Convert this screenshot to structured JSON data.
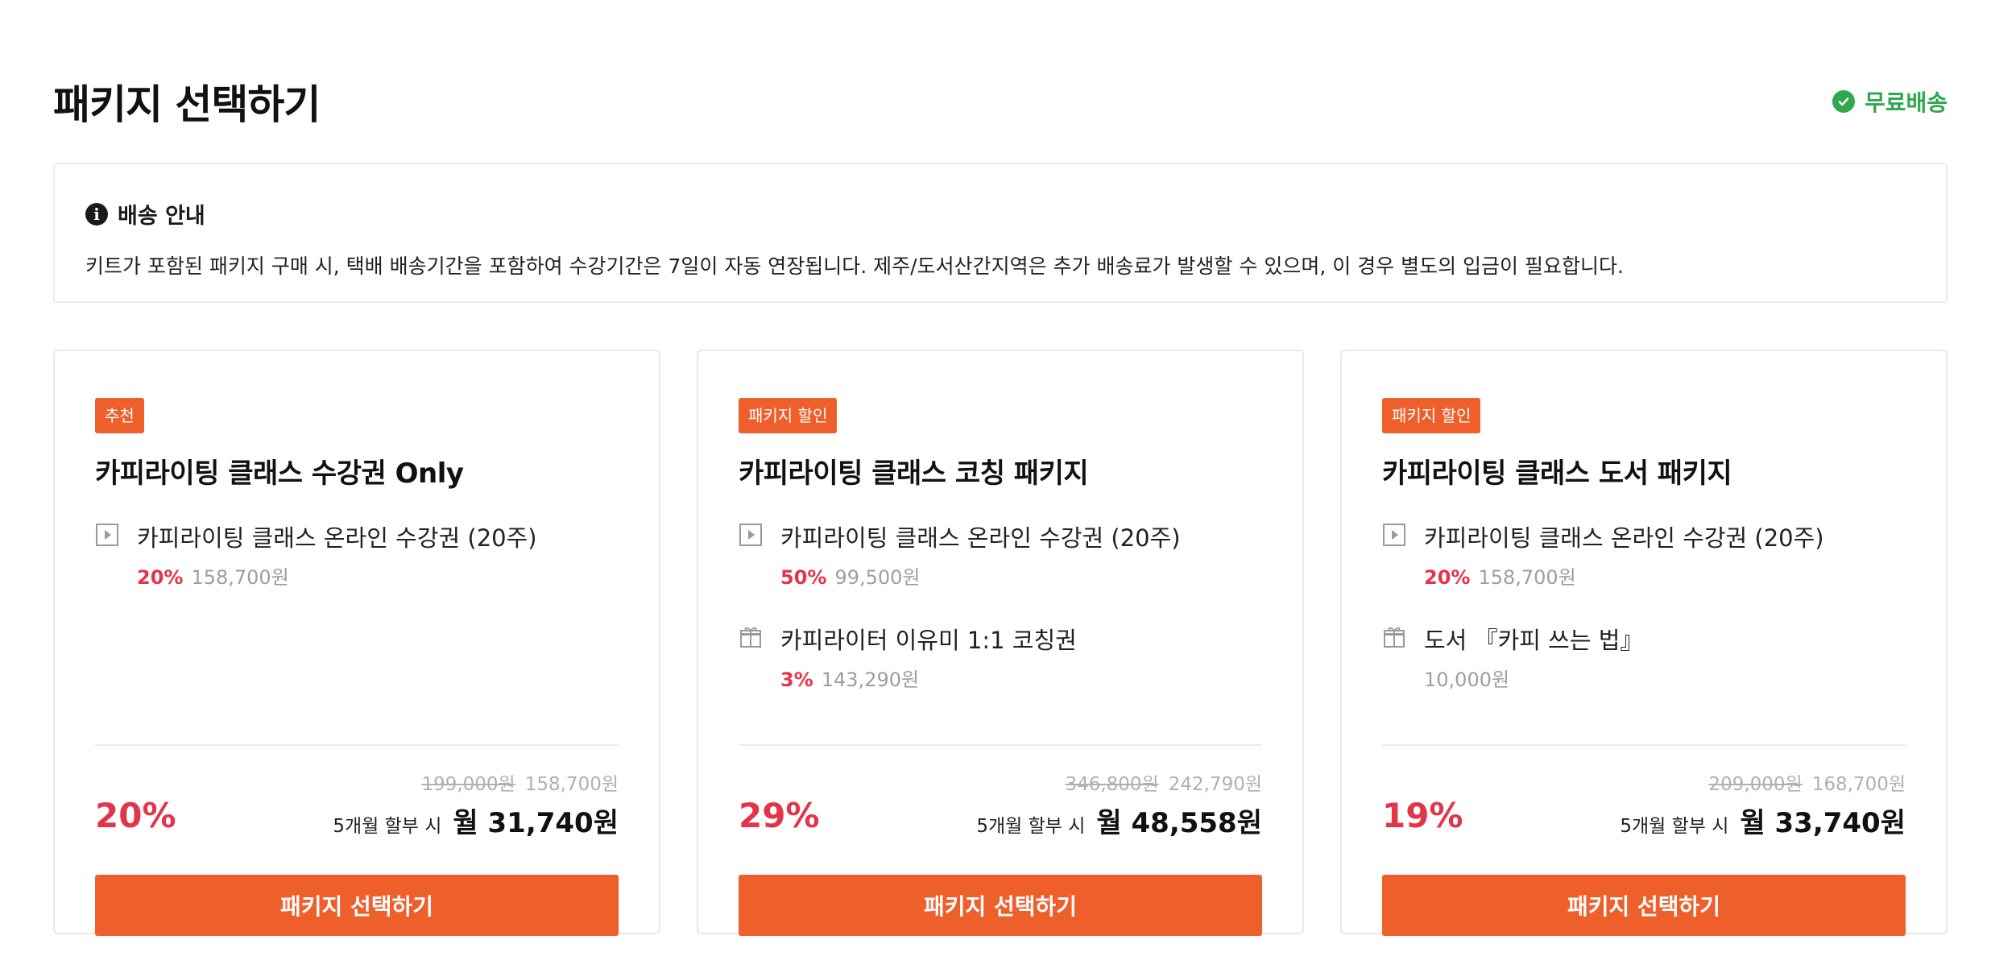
{
  "header": {
    "title": "패키지 선택하기",
    "free_shipping": "무료배송",
    "free_shipping_color": "#2fa84f"
  },
  "notice": {
    "title": "배송 안내",
    "body": "키트가 포함된 패키지 구매 시, 택배 배송기간을 포함하여 수강기간은 7일이 자동 연장됩니다. 제주/도서산간지역은 추가 배송료가 발생할 수 있으며, 이 경우 별도의 입금이 필요합니다."
  },
  "accent_color": "#ee5f2c",
  "discount_color": "#e3354a",
  "cards": [
    {
      "tag": "추천",
      "title": "카피라이팅 클래스 수강권 Only",
      "items": [
        {
          "icon": "play-icon",
          "name": "카피라이팅 클래스 온라인 수강권 (20주)",
          "rate": "20%",
          "price": "158,700원"
        }
      ],
      "original_price": "199,000원",
      "sale_price": "158,700원",
      "discount_rate": "20%",
      "installment_label": "5개월 할부 시",
      "monthly_price": "월 31,740원",
      "button_label": "패키지 선택하기"
    },
    {
      "tag": "패키지 할인",
      "title": "카피라이팅 클래스 코칭 패키지",
      "items": [
        {
          "icon": "play-icon",
          "name": "카피라이팅 클래스 온라인 수강권 (20주)",
          "rate": "50%",
          "price": "99,500원"
        },
        {
          "icon": "gift-icon",
          "name": "카피라이터 이유미 1:1 코칭권",
          "rate": "3%",
          "price": "143,290원"
        }
      ],
      "original_price": "346,800원",
      "sale_price": "242,790원",
      "discount_rate": "29%",
      "installment_label": "5개월 할부 시",
      "monthly_price": "월 48,558원",
      "button_label": "패키지 선택하기"
    },
    {
      "tag": "패키지 할인",
      "title": "카피라이팅 클래스 도서 패키지",
      "items": [
        {
          "icon": "play-icon",
          "name": "카피라이팅 클래스 온라인 수강권 (20주)",
          "rate": "20%",
          "price": "158,700원"
        },
        {
          "icon": "gift-icon",
          "name": "도서 『카피 쓰는 법』",
          "rate": "",
          "price": "10,000원"
        }
      ],
      "original_price": "209,000원",
      "sale_price": "168,700원",
      "discount_rate": "19%",
      "installment_label": "5개월 할부 시",
      "monthly_price": "월 33,740원",
      "button_label": "패키지 선택하기"
    }
  ]
}
